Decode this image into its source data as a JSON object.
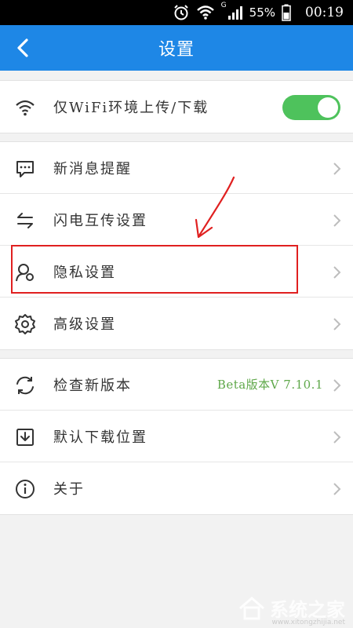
{
  "status_bar": {
    "network_type": "G",
    "battery": "55%",
    "time": "00:19",
    "icons": [
      "alarm-icon",
      "wifi-icon",
      "signal-icon",
      "battery-icon"
    ]
  },
  "header": {
    "title": "设置",
    "back_icon": "chevron-left-icon"
  },
  "groups": [
    {
      "items": [
        {
          "label": "仅WiFi环境上传/下载",
          "icon": "wifi-icon",
          "toggle_on": true
        }
      ]
    },
    {
      "items": [
        {
          "label": "新消息提醒",
          "icon": "message-icon"
        },
        {
          "label": "闪电互传设置",
          "icon": "transfer-arrows-icon"
        },
        {
          "label": "隐私设置",
          "icon": "privacy-user-icon",
          "highlighted": true
        },
        {
          "label": "高级设置",
          "icon": "gear-icon"
        }
      ]
    },
    {
      "items": [
        {
          "label": "检查新版本",
          "icon": "refresh-icon",
          "value": "Beta版本V 7.10.1"
        },
        {
          "label": "默认下载位置",
          "icon": "download-box-icon"
        },
        {
          "label": "关于",
          "icon": "info-icon"
        }
      ]
    }
  ],
  "colors": {
    "appbar": "#1e87e6",
    "toggle_on": "#4ec25c",
    "version_text": "#5fa84a",
    "annotation": "#e02020"
  },
  "watermark": {
    "text": "系统之家",
    "sub": "www.xitongzhijia.net"
  }
}
